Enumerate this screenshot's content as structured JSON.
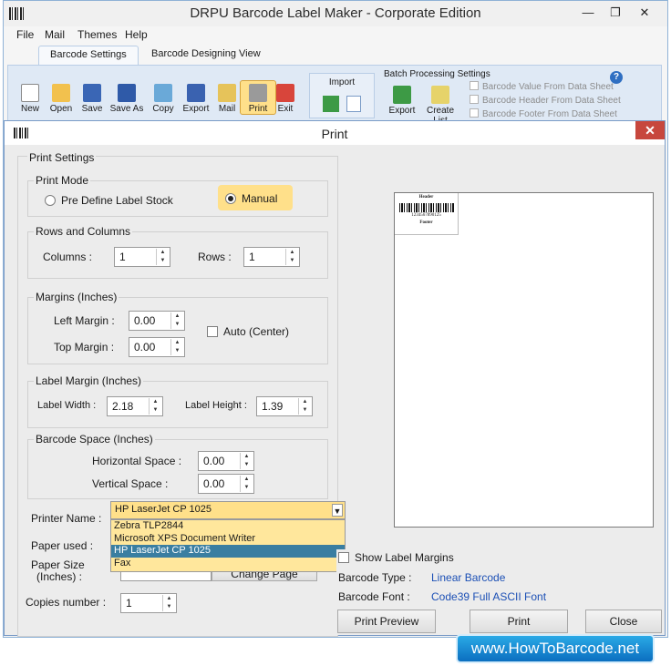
{
  "app": {
    "title": "DRPU Barcode Label Maker - Corporate Edition"
  },
  "window_controls": {
    "minimize": "—",
    "maximize": "❐",
    "close": "✕"
  },
  "menu": {
    "items": [
      "File",
      "Mail",
      "Themes",
      "Help"
    ]
  },
  "tabs": [
    {
      "label": "Barcode Settings",
      "active": true
    },
    {
      "label": "Barcode Designing View",
      "active": false
    }
  ],
  "toolbar": {
    "buttons": [
      {
        "label": "New",
        "icon": "new-document-icon"
      },
      {
        "label": "Open",
        "icon": "open-folder-icon"
      },
      {
        "label": "Save",
        "icon": "save-disk-icon"
      },
      {
        "label": "Save As",
        "icon": "save-as-icon"
      },
      {
        "label": "Copy",
        "icon": "copy-icon"
      },
      {
        "label": "Export",
        "icon": "export-icon"
      },
      {
        "label": "Mail",
        "icon": "mail-envelope-icon"
      },
      {
        "label": "Print",
        "icon": "printer-icon",
        "active": true
      },
      {
        "label": "Exit",
        "icon": "exit-icon"
      }
    ],
    "import_group": {
      "title": "Import"
    },
    "batch_group": {
      "title": "Batch Processing Settings",
      "export_label": "Export",
      "create_list_label": "Create List",
      "checks": [
        "Barcode Value From Data Sheet",
        "Barcode Header From Data Sheet",
        "Barcode Footer From Data Sheet"
      ],
      "help": "?"
    }
  },
  "dialog": {
    "title": "Print",
    "close": "✕",
    "print_settings": {
      "title": "Print Settings",
      "print_mode": {
        "title": "Print Mode",
        "option_predefined": "Pre Define Label Stock",
        "option_manual": "Manual",
        "selected": "Manual"
      },
      "rows_columns": {
        "title": "Rows and Columns",
        "columns_label": "Columns :",
        "columns_value": "1",
        "rows_label": "Rows :",
        "rows_value": "1"
      },
      "margins": {
        "title": "Margins (Inches)",
        "left_label": "Left Margin :",
        "left_value": "0.00",
        "top_label": "Top Margin :",
        "top_value": "0.00",
        "auto_center_label": "Auto (Center)",
        "auto_center_checked": false
      },
      "label_margin": {
        "title": "Label Margin (Inches)",
        "width_label": "Label Width :",
        "width_value": "2.18",
        "height_label": "Label Height :",
        "height_value": "1.39"
      },
      "barcode_space": {
        "title": "Barcode Space (Inches)",
        "horizontal_label": "Horizontal Space :",
        "horizontal_value": "0.00",
        "vertical_label": "Vertical Space :",
        "vertical_value": "0.00"
      },
      "printer": {
        "name_label": "Printer Name :",
        "selected": "HP LaserJet CP 1025",
        "options": [
          "Zebra TLP2844",
          "Microsoft XPS Document Writer",
          "HP LaserJet CP 1025",
          "Fax"
        ],
        "paper_used_label": "Paper used :",
        "paper_size_label": "Paper Size",
        "paper_size_unit": "(Inches) :",
        "change_page_label": "Change Page"
      },
      "copies_label": "Copies number :",
      "copies_value": "1"
    },
    "preview": {
      "header": "Header",
      "footer": "Footer",
      "barcode_number": "1234567890125"
    },
    "show_label_margins": "Show Label Margins",
    "barcode_type_label": "Barcode Type :",
    "barcode_type_value": "Linear Barcode",
    "barcode_font_label": "Barcode Font :",
    "barcode_font_value": "Code39 Full ASCII Font",
    "buttons": {
      "print_preview": "Print Preview",
      "print": "Print",
      "close": "Close"
    }
  },
  "watermark": "www.HowToBarcode.net"
}
